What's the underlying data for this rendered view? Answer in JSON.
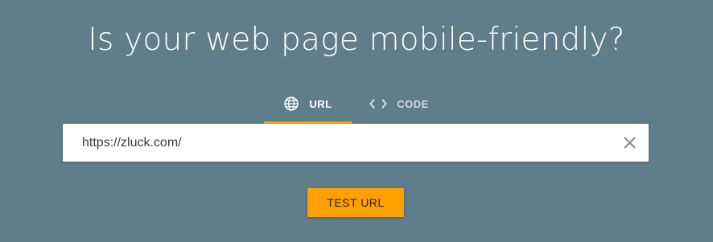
{
  "header": {
    "title": "Is your web page mobile-friendly?"
  },
  "tabs": [
    {
      "label": "URL",
      "icon": "globe-icon",
      "active": true
    },
    {
      "label": "CODE",
      "icon": "code-icon",
      "active": false
    }
  ],
  "url_input": {
    "value": "https://zluck.com/"
  },
  "actions": {
    "test_label": "TEST URL"
  },
  "colors": {
    "background": "#607d8b",
    "accent": "#ffa000",
    "input_background": "#ffffff"
  }
}
